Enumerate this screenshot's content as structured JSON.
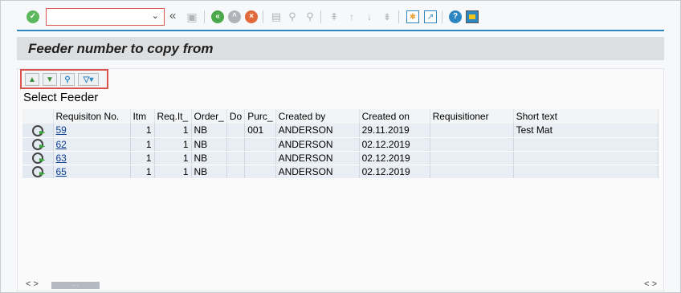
{
  "toolbar": {
    "command_field_value": "",
    "icons": [
      "enter-icon",
      "save-icon",
      "back-icon",
      "exit-icon",
      "cancel-icon",
      "print-icon",
      "find-icon",
      "find-next-icon",
      "first-page-icon",
      "previous-page-icon",
      "next-page-icon",
      "last-page-icon",
      "create-session-icon",
      "shortcut-icon",
      "help-icon",
      "customize-layout-icon"
    ],
    "accent_color": "#2e86c1"
  },
  "title": "Feeder number to copy from",
  "alv_toolbar": {
    "icons": [
      "sort-ascending-icon",
      "sort-descending-icon",
      "find-icon",
      "filter-icon"
    ]
  },
  "section_title": "Select Feeder",
  "table": {
    "columns": [
      "",
      "Requisiton No.",
      "Itm",
      "Req.It_",
      "Order_",
      "Do",
      "Purc_",
      "Created by",
      "Created on",
      "Requisitioner",
      "Short text"
    ],
    "rows": [
      {
        "req_no": "59",
        "itm": "1",
        "req_it": "1",
        "order": "NB",
        "do": "",
        "purc": "001",
        "created_by": "ANDERSON",
        "created_on": "29.11.2019",
        "requisitioner": "",
        "short_text": "Test Mat"
      },
      {
        "req_no": "62",
        "itm": "1",
        "req_it": "1",
        "order": "NB",
        "do": "",
        "purc": "",
        "created_by": "ANDERSON",
        "created_on": "02.12.2019",
        "requisitioner": "",
        "short_text": ""
      },
      {
        "req_no": "63",
        "itm": "1",
        "req_it": "1",
        "order": "NB",
        "do": "",
        "purc": "",
        "created_by": "ANDERSON",
        "created_on": "02.12.2019",
        "requisitioner": "",
        "short_text": ""
      },
      {
        "req_no": "65",
        "itm": "1",
        "req_it": "1",
        "order": "NB",
        "do": "",
        "purc": "",
        "created_by": "ANDERSON",
        "created_on": "02.12.2019",
        "requisitioner": "",
        "short_text": ""
      }
    ]
  },
  "scrollbar": {
    "left_arrows": "< >",
    "right_arrows": "< >",
    "thumb_label": "···"
  }
}
